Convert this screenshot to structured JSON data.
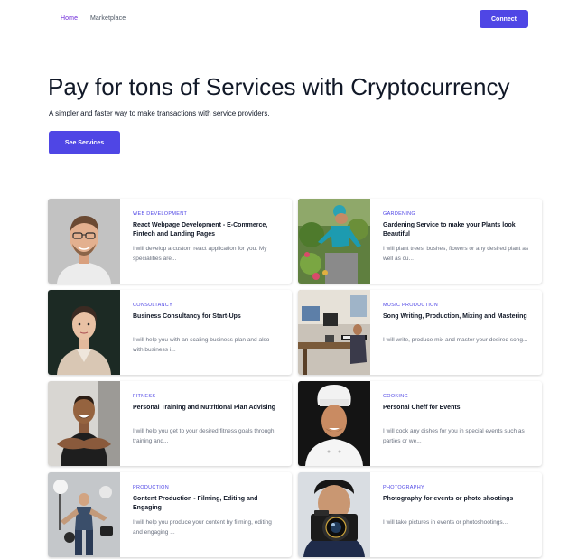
{
  "nav": {
    "home": "Home",
    "marketplace": "Marketplace",
    "connect": "Connect"
  },
  "hero": {
    "title": "Pay for tons of Services with Cryptocurrency",
    "subtitle": "A simpler and faster way to make transactions with service providers.",
    "cta": "See Services"
  },
  "colors": {
    "accent": "#4f46e5",
    "nav_active": "#6d28d9"
  },
  "services": [
    {
      "category": "WEB DEVELOPMENT",
      "title": "React Webpage Development - E-Commerce, Fintech and Landing Pages",
      "description": "I will develop a custom react application for you. My specialities are...",
      "image": "man-with-glasses-photo"
    },
    {
      "category": "GARDENING",
      "title": "Gardening Service to make your Plants look Beautiful",
      "description": "I will plant trees, bushes, flowers or any desired plant as well as cu...",
      "image": "gardener-with-plants-photo"
    },
    {
      "category": "CONSULTANCY",
      "title": "Business Consultancy for Start-Ups",
      "description": "I will help you with an scaling business plan and also with business i...",
      "image": "businesswoman-photo"
    },
    {
      "category": "MUSIC PRODUCTION",
      "title": "Song Writing, Production, Mixing and Mastering",
      "description": "I will write, produce mix and master your desired song...",
      "image": "music-studio-photo"
    },
    {
      "category": "FITNESS",
      "title": "Personal Training and Nutritional Plan Advising",
      "description": "I will help you get to your desired fitness goals through training and...",
      "image": "fitness-trainer-photo"
    },
    {
      "category": "COOKING",
      "title": "Personal Cheff for Events",
      "description": "I will cook any dishes for you in special events such as parties or we...",
      "image": "chef-photo"
    },
    {
      "category": "PRODUCTION",
      "title": "Content Production - Filming, Editing and Engaging",
      "description": "I will help you produce your content by filming, editing and engaging ...",
      "image": "production-montage-photo"
    },
    {
      "category": "PHOTOGRAPHY",
      "title": "Photography for events or photo shootings",
      "description": "I will take pictures in events or photoshootings...",
      "image": "photographer-camera-photo"
    }
  ]
}
